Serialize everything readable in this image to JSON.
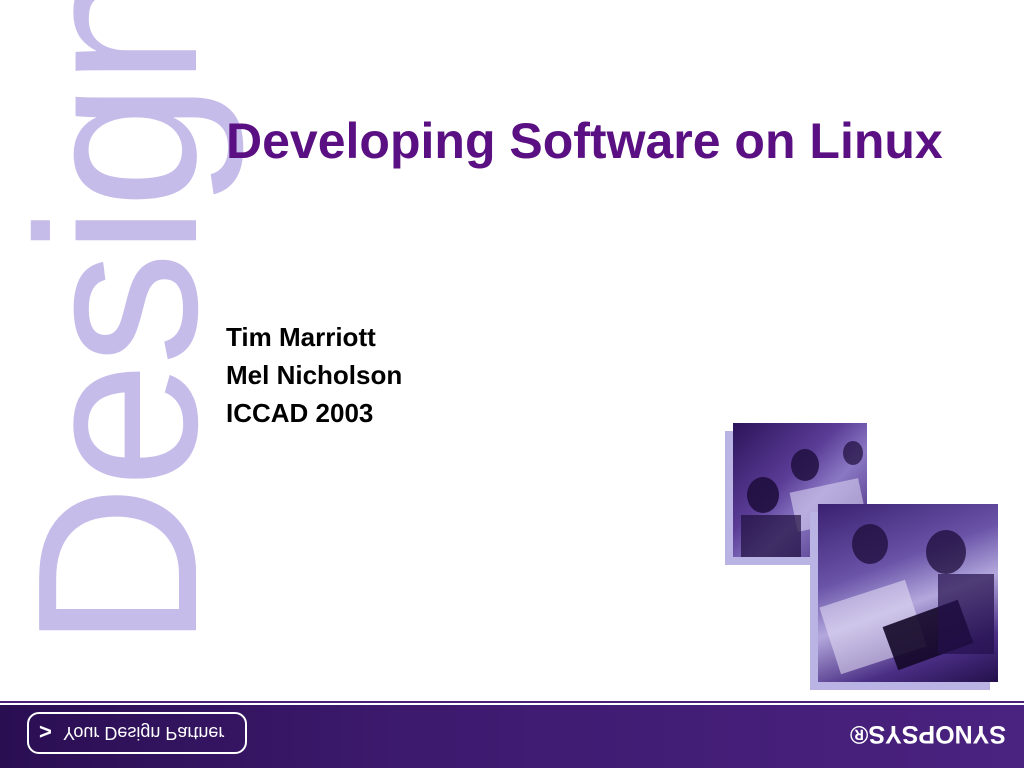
{
  "watermark": "Design",
  "title": "Developing Software on Linux",
  "authors": [
    "Tim Marriott",
    "Mel Nicholson",
    "ICCAD 2003"
  ],
  "footer": {
    "tagline": "Your Design Partner",
    "logo": "SYNOPSYS®"
  },
  "colors": {
    "title": "#5a0f82",
    "watermark": "#c6bcea",
    "footer": "#3d1a6e"
  }
}
